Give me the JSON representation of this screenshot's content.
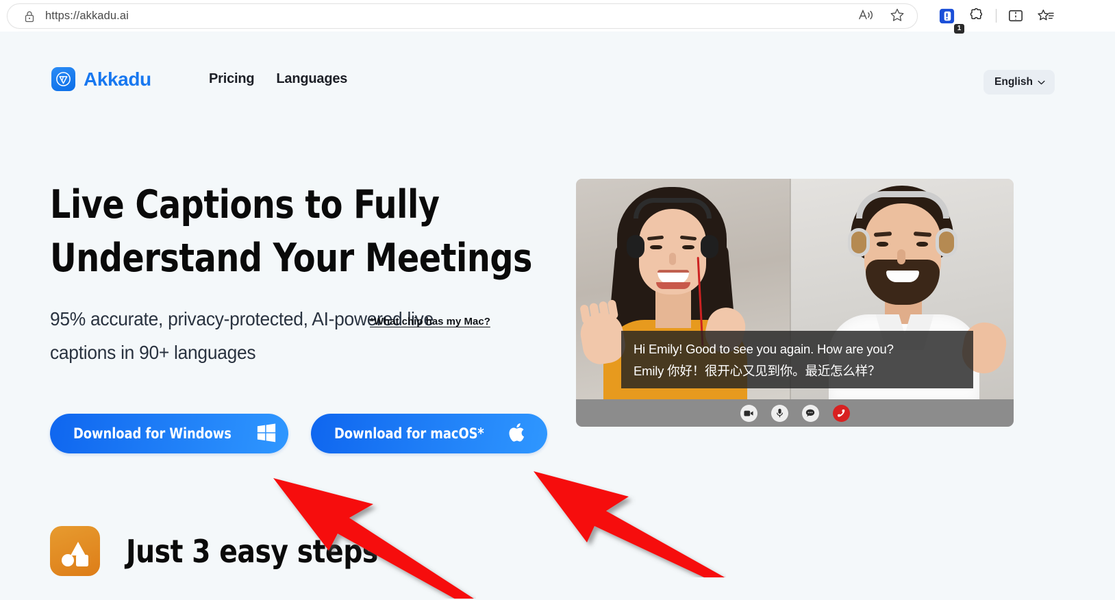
{
  "browser": {
    "url": "https://akkadu.ai",
    "lock_icon": "lock-icon",
    "read_aloud_icon": "read-aloud-icon",
    "favorites_icon": "favorite-star-icon",
    "extension_badge_count": "1",
    "extensions_icon": "extensions-puzzle-icon",
    "split_screen_icon": "split-screen-icon",
    "collections_icon": "collections-icon"
  },
  "site": {
    "logo_text": "Akkadu",
    "logo_icon": "akkadu-logo-icon",
    "nav": [
      {
        "label": "Pricing"
      },
      {
        "label": "Languages"
      }
    ],
    "language_selector": {
      "label": "English",
      "chevron_icon": "chevron-down-icon"
    }
  },
  "hero": {
    "headline_line1": "Live Captions to Fully",
    "headline_line2": "Understand Your Meetings",
    "subhead_line1": "95% accurate, privacy-protected, AI-powered live",
    "subhead_line2": "captions in 90+ languages",
    "buttons": [
      {
        "label": "Download for Windows",
        "icon": "windows-logo-icon"
      },
      {
        "label": "Download for macOS*",
        "icon": "apple-logo-icon"
      }
    ],
    "chip_link": "*What chip has my Mac?"
  },
  "video_mock": {
    "caption_english": "Hi Emily! Good to see you again. How are you?",
    "caption_chinese": "Emily 你好！很开心又见到你。最近怎么样？",
    "controls": [
      {
        "name": "camera-icon"
      },
      {
        "name": "microphone-icon"
      },
      {
        "name": "chat-bubble-icon"
      },
      {
        "name": "end-call-icon"
      }
    ]
  },
  "steps_section": {
    "icon": "shapes-icon",
    "title": "Just 3 easy steps"
  },
  "annotations": {
    "arrow1": "red-arrow-pointing-to-windows-button",
    "arrow2": "red-arrow-pointing-to-macos-button",
    "arrow_color": "#f60f0f"
  },
  "colors": {
    "page_background": "#f4f8fa",
    "brand_blue": "#1878f0",
    "button_gradient_start": "#0f66ef",
    "button_gradient_end": "#2f97ff",
    "accent_orange": "#dd7d18",
    "heading_black": "#0a0a0a"
  }
}
